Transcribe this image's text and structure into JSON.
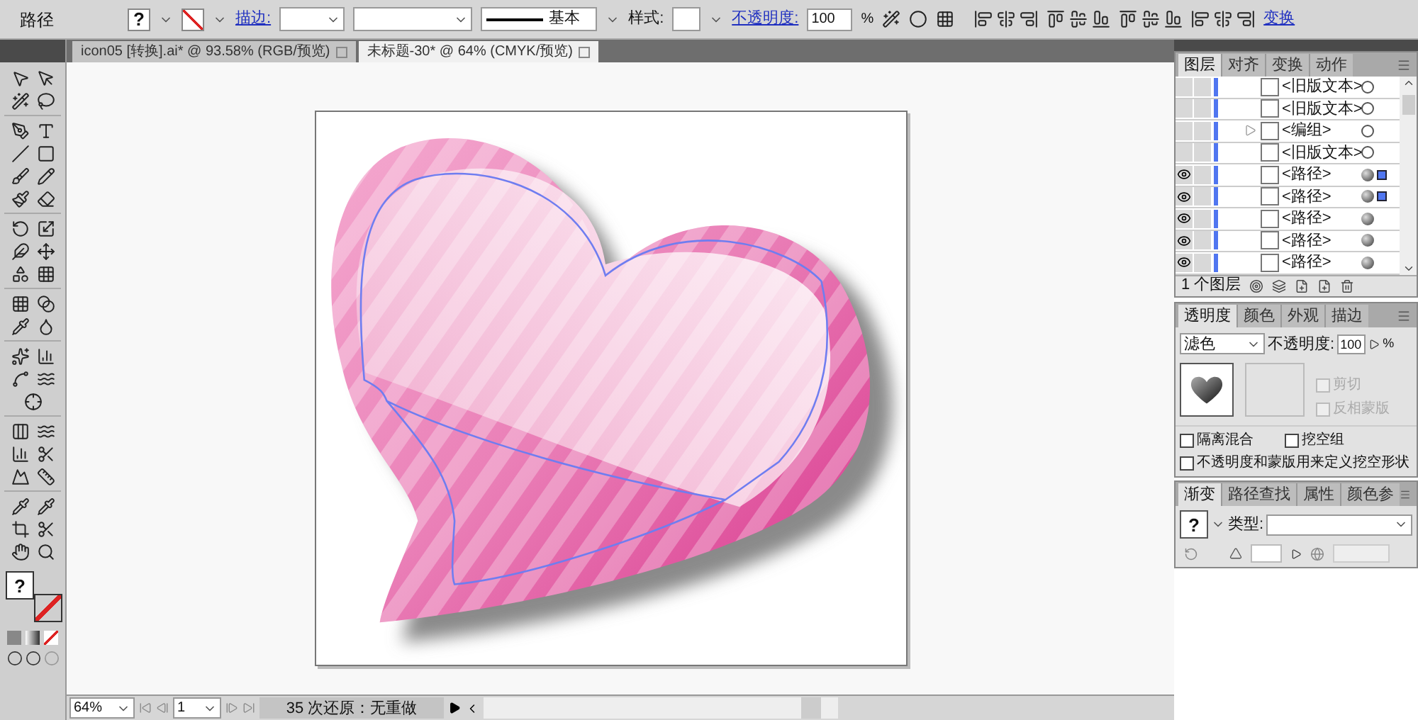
{
  "control_bar": {
    "selection_label": "路径",
    "fill_swatch": "?",
    "stroke_link": "描边:",
    "stroke_profile": "基本",
    "style_label": "样式:",
    "opacity_link": "不透明度:",
    "opacity_value": "100",
    "opacity_unit": "%",
    "transform_link": "变换"
  },
  "document_tabs": [
    {
      "label": "icon05 [转换].ai* @ 93.58% (RGB/预览)",
      "selected": false
    },
    {
      "label": "未标题-30* @ 64% (CMYK/预览)",
      "selected": true
    }
  ],
  "toolbox": {
    "fill_swatch": "?"
  },
  "layers_panel": {
    "tabs": [
      {
        "label": "图层",
        "selected": true
      },
      {
        "label": "对齐",
        "selected": false
      },
      {
        "label": "变换",
        "selected": false
      },
      {
        "label": "动作",
        "selected": false
      }
    ],
    "layers": [
      {
        "name": "<旧版文本>",
        "visible": false,
        "has_children": false,
        "has_appearance": false,
        "selected": false
      },
      {
        "name": "<旧版文本>",
        "visible": false,
        "has_children": false,
        "has_appearance": false,
        "selected": false
      },
      {
        "name": "<编组>",
        "visible": false,
        "has_children": true,
        "has_appearance": false,
        "selected": false
      },
      {
        "name": "<旧版文本>",
        "visible": false,
        "has_children": false,
        "has_appearance": false,
        "selected": false
      },
      {
        "name": "<路径>",
        "visible": true,
        "has_children": false,
        "has_appearance": true,
        "selected": true
      },
      {
        "name": "<路径>",
        "visible": true,
        "has_children": false,
        "has_appearance": true,
        "selected": true
      },
      {
        "name": "<路径>",
        "visible": true,
        "has_children": false,
        "has_appearance": true,
        "selected": false
      },
      {
        "name": "<路径>",
        "visible": true,
        "has_children": false,
        "has_appearance": true,
        "selected": false
      },
      {
        "name": "<路径>",
        "visible": true,
        "has_children": false,
        "has_appearance": true,
        "selected": false
      }
    ],
    "footer": "1 个图层"
  },
  "transparency_panel": {
    "tabs": [
      {
        "label": "透明度",
        "selected": true
      },
      {
        "label": "颜色",
        "selected": false
      },
      {
        "label": "外观",
        "selected": false
      },
      {
        "label": "描边",
        "selected": false
      }
    ],
    "blend_mode": "滤色",
    "opacity_label": "不透明度:",
    "opacity_value": "100",
    "opacity_unit": "%",
    "mask_options": [
      {
        "label": "剪切",
        "checked": false,
        "disabled": true
      },
      {
        "label": "反相蒙版",
        "checked": false,
        "disabled": true
      }
    ],
    "options": [
      {
        "label": "隔离混合",
        "checked": false,
        "disabled": false
      },
      {
        "label": "挖空组",
        "checked": false,
        "disabled": false
      },
      {
        "label": "不透明度和蒙版用来定义挖空形状",
        "checked": false,
        "disabled": false
      }
    ]
  },
  "gradient_panel": {
    "tabs": [
      {
        "label": "渐变",
        "selected": true
      },
      {
        "label": "路径查找",
        "selected": false
      },
      {
        "label": "属性",
        "selected": false
      },
      {
        "label": "颜色参",
        "selected": false
      }
    ],
    "swatch": "?",
    "type_label": "类型:"
  },
  "status_bar": {
    "zoom": "64%",
    "artboard": "1",
    "history": "35 次还原：无重做"
  }
}
